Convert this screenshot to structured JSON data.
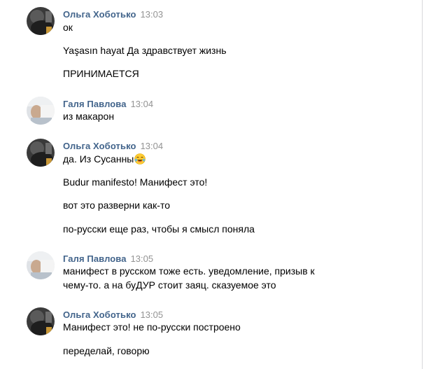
{
  "messages": [
    {
      "author": "Ольга Хоботько",
      "time": "13:03",
      "avatar_icon": "avatar-dark-photo",
      "lines": [
        "ок",
        "Yaşasın hayat Да здравствует жизнь",
        "ПРИНИМАЕТСЯ"
      ]
    },
    {
      "author": "Галя Павлова",
      "time": "13:04",
      "avatar_icon": "avatar-light-photo",
      "lines": [
        "из макарон"
      ]
    },
    {
      "author": "Ольга Хоботько",
      "time": "13:04",
      "avatar_icon": "avatar-dark-photo",
      "lines": [
        "да. Из Сусанны",
        "Budur manifesto! Манифест это!",
        "вот это разверни как-то",
        "по-русски еще раз, чтобы я смысл поняла"
      ],
      "emoji_icon": "laughing-tears-emoji-icon"
    },
    {
      "author": "Галя Павлова",
      "time": "13:05",
      "avatar_icon": "avatar-light-photo",
      "lines": [
        "манифест в русском тоже есть. уведомление, призыв к",
        "чему-то. а на буДУР стоит заяц. сказуемое это"
      ]
    },
    {
      "author": "Ольга Хоботько",
      "time": "13:05",
      "avatar_icon": "avatar-dark-photo",
      "lines": [
        "Манифест это! не по-русски построено",
        "переделай, говорю"
      ]
    }
  ],
  "colors": {
    "author": "#42648b",
    "time": "#939393",
    "text": "#000000",
    "background": "#ffffff"
  }
}
